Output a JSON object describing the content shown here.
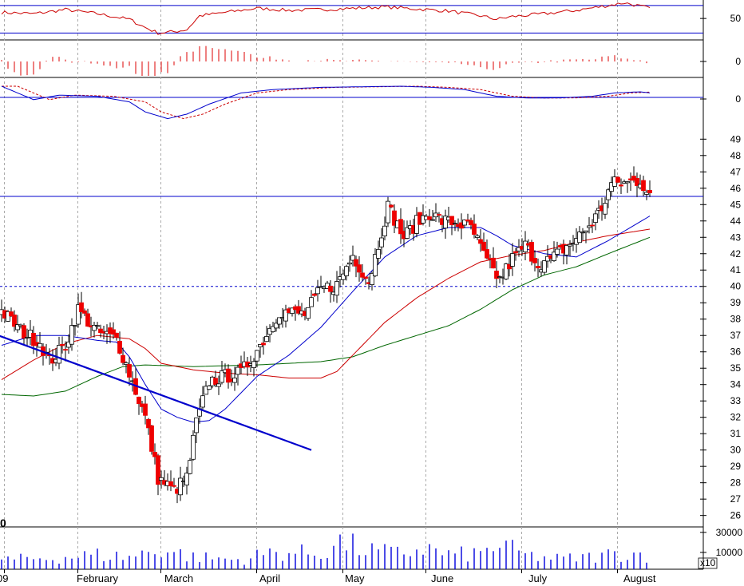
{
  "chart_data": {
    "type": "candlestick",
    "title": "",
    "xlabel": "",
    "ylabel": "",
    "x_ticks": [
      "09",
      "February",
      "March",
      "April",
      "May",
      "June",
      "July",
      "August"
    ],
    "y_ticks": [
      26,
      27,
      28,
      29,
      30,
      31,
      32,
      33,
      34,
      35,
      36,
      37,
      38,
      39,
      40,
      41,
      42,
      43,
      44,
      45,
      46,
      47,
      48,
      49
    ],
    "ylim": [
      25.3,
      49.6
    ],
    "rsi_panel": {
      "ticks": [
        50
      ],
      "levels": [
        70,
        30
      ],
      "ylim": [
        20,
        78
      ]
    },
    "macd_hist_panel": {
      "ticks": [
        0
      ]
    },
    "macd_panel": {
      "ticks": [
        0
      ]
    },
    "volume_panel": {
      "ticks": [
        30000,
        10000
      ],
      "multiplier_label": "x10",
      "corner_label": "0"
    },
    "horizontal_lines": [
      45.5,
      40.0
    ],
    "trendline": {
      "start": [
        -1,
        37.0
      ],
      "end": [
        97,
        30.0
      ]
    },
    "price_anchors": [
      [
        0,
        38.5
      ],
      [
        6,
        37.3
      ],
      [
        12,
        36.6
      ],
      [
        15,
        35.4
      ],
      [
        20,
        36.4
      ],
      [
        24,
        38.6
      ],
      [
        30,
        37.2
      ],
      [
        36,
        36.8
      ],
      [
        40,
        34.7
      ],
      [
        45,
        32.0
      ],
      [
        49,
        28.3
      ],
      [
        54,
        27.5
      ],
      [
        58,
        28.3
      ],
      [
        61,
        31.7
      ],
      [
        65,
        34.2
      ],
      [
        70,
        34.5
      ],
      [
        75,
        34.7
      ],
      [
        81,
        36.4
      ],
      [
        87,
        38.5
      ],
      [
        95,
        38.3
      ],
      [
        100,
        39.8
      ],
      [
        105,
        40.1
      ],
      [
        110,
        41.9
      ],
      [
        115,
        40.3
      ],
      [
        118,
        42.6
      ],
      [
        121,
        44.9
      ],
      [
        126,
        43.0
      ],
      [
        130,
        43.9
      ],
      [
        134,
        44.5
      ],
      [
        138,
        44.0
      ],
      [
        142,
        43.9
      ],
      [
        147,
        43.6
      ],
      [
        152,
        41.5
      ],
      [
        156,
        40.4
      ],
      [
        160,
        41.7
      ],
      [
        164,
        42.5
      ],
      [
        168,
        41.4
      ],
      [
        172,
        41.6
      ],
      [
        176,
        42.3
      ],
      [
        180,
        42.9
      ],
      [
        184,
        43.7
      ],
      [
        188,
        44.8
      ],
      [
        191,
        46.3
      ],
      [
        195,
        46.3
      ],
      [
        200,
        46.5
      ],
      [
        203,
        45.6
      ]
    ],
    "ma_short_anchors": [
      [
        0,
        36.4
      ],
      [
        10,
        37.0
      ],
      [
        20,
        37.0
      ],
      [
        30,
        36.7
      ],
      [
        36,
        36.6
      ],
      [
        40,
        35.7
      ],
      [
        45,
        34.0
      ],
      [
        50,
        32.5
      ],
      [
        55,
        32.0
      ],
      [
        60,
        31.7
      ],
      [
        65,
        31.8
      ],
      [
        70,
        32.5
      ],
      [
        75,
        33.5
      ],
      [
        80,
        34.5
      ],
      [
        90,
        35.8
      ],
      [
        100,
        37.5
      ],
      [
        110,
        39.7
      ],
      [
        120,
        41.8
      ],
      [
        130,
        43.1
      ],
      [
        140,
        43.6
      ],
      [
        150,
        43.6
      ],
      [
        155,
        43.1
      ],
      [
        160,
        42.5
      ],
      [
        170,
        42.0
      ],
      [
        180,
        41.8
      ],
      [
        190,
        42.8
      ],
      [
        203,
        44.3
      ]
    ],
    "ma_mid_anchors": [
      [
        0,
        34.3
      ],
      [
        10,
        35.5
      ],
      [
        20,
        36.5
      ],
      [
        30,
        37.0
      ],
      [
        40,
        36.8
      ],
      [
        45,
        36.2
      ],
      [
        50,
        35.3
      ],
      [
        60,
        34.9
      ],
      [
        70,
        34.7
      ],
      [
        80,
        34.6
      ],
      [
        90,
        34.4
      ],
      [
        100,
        34.4
      ],
      [
        105,
        34.8
      ],
      [
        110,
        35.8
      ],
      [
        120,
        37.8
      ],
      [
        130,
        39.3
      ],
      [
        140,
        40.5
      ],
      [
        150,
        41.5
      ],
      [
        160,
        41.9
      ],
      [
        170,
        42.2
      ],
      [
        180,
        42.7
      ],
      [
        190,
        43.1
      ],
      [
        203,
        43.5
      ]
    ],
    "ma_long_anchors": [
      [
        0,
        33.4
      ],
      [
        10,
        33.3
      ],
      [
        20,
        33.6
      ],
      [
        30,
        34.5
      ],
      [
        38,
        35.1
      ],
      [
        45,
        35.2
      ],
      [
        60,
        35.1
      ],
      [
        80,
        35.2
      ],
      [
        100,
        35.4
      ],
      [
        110,
        35.7
      ],
      [
        120,
        36.4
      ],
      [
        130,
        37.0
      ],
      [
        140,
        37.6
      ],
      [
        150,
        38.6
      ],
      [
        160,
        39.8
      ],
      [
        170,
        40.7
      ],
      [
        180,
        41.2
      ],
      [
        190,
        42.0
      ],
      [
        203,
        43.0
      ]
    ],
    "rsi_anchors": [
      [
        0,
        60
      ],
      [
        10,
        58
      ],
      [
        20,
        64
      ],
      [
        30,
        58
      ],
      [
        40,
        50
      ],
      [
        45,
        38
      ],
      [
        49,
        30
      ],
      [
        54,
        32
      ],
      [
        58,
        35
      ],
      [
        62,
        55
      ],
      [
        70,
        60
      ],
      [
        80,
        66
      ],
      [
        90,
        63
      ],
      [
        100,
        64
      ],
      [
        110,
        66
      ],
      [
        120,
        68
      ],
      [
        130,
        65
      ],
      [
        140,
        62
      ],
      [
        150,
        55
      ],
      [
        155,
        50
      ],
      [
        160,
        54
      ],
      [
        170,
        58
      ],
      [
        180,
        63
      ],
      [
        190,
        70
      ],
      [
        195,
        74
      ],
      [
        203,
        66
      ]
    ],
    "macd_anchors": [
      [
        0,
        0.5
      ],
      [
        10,
        -0.1
      ],
      [
        18,
        0.1
      ],
      [
        30,
        0.05
      ],
      [
        40,
        -0.2
      ],
      [
        45,
        -0.65
      ],
      [
        52,
        -0.95
      ],
      [
        58,
        -0.75
      ],
      [
        65,
        -0.3
      ],
      [
        75,
        0.2
      ],
      [
        85,
        0.35
      ],
      [
        100,
        0.45
      ],
      [
        115,
        0.48
      ],
      [
        125,
        0.5
      ],
      [
        135,
        0.45
      ],
      [
        145,
        0.35
      ],
      [
        155,
        0.05
      ],
      [
        165,
        -0.03
      ],
      [
        175,
        -0.02
      ],
      [
        185,
        0.05
      ],
      [
        192,
        0.2
      ],
      [
        200,
        0.25
      ],
      [
        203,
        0.2
      ]
    ],
    "volume_anchors": [
      [
        0,
        9000
      ],
      [
        15,
        11000
      ],
      [
        30,
        14000
      ],
      [
        40,
        12000
      ],
      [
        50,
        20000
      ],
      [
        60,
        12000
      ],
      [
        75,
        9000
      ],
      [
        85,
        17000
      ],
      [
        100,
        15000
      ],
      [
        105,
        27000
      ],
      [
        115,
        18000
      ],
      [
        125,
        15000
      ],
      [
        132,
        21000
      ],
      [
        140,
        14000
      ],
      [
        150,
        15000
      ],
      [
        155,
        24000
      ],
      [
        165,
        13000
      ],
      [
        175,
        10000
      ],
      [
        185,
        12000
      ],
      [
        195,
        16000
      ],
      [
        203,
        14000
      ]
    ],
    "colors": {
      "up_candle": "#ffffff",
      "down_candle": "#ee0000",
      "ma_short": "#0000cc",
      "ma_mid": "#cc0000",
      "ma_long": "#006600",
      "rsi": "#cc0000",
      "macd": "#0000cc",
      "macd_signal": "#cc0000",
      "histogram": "#dd0000",
      "volume": "#0000dd",
      "hline": "#0000cc",
      "trendline": "#0000cc",
      "grid": "#aaaaaa"
    }
  }
}
